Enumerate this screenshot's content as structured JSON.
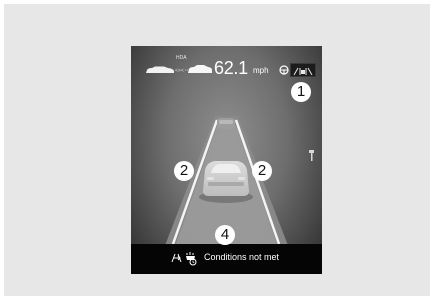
{
  "hud": {
    "mode_label": "HDA",
    "speed_value": "62.1",
    "speed_unit": "mph"
  },
  "status": {
    "message": "Conditions not met"
  },
  "callouts": [
    "1",
    "2",
    "2",
    "4"
  ],
  "colors": {
    "frame_background": "#e7e7e7",
    "hud_text": "#ffffff",
    "status_bar": "#050505",
    "callout_circle": "#ffffff"
  },
  "icons": {
    "lead_vehicle": "car-silhouette-icon",
    "follow_distance": "distance-arrows-icon",
    "steering": "steering-wheel-icon",
    "lane_assist": "lane-following-icon",
    "lane_status": "lane-change-icon",
    "hands_off": "hand-icon",
    "ego_vehicle": "car-rear-icon"
  }
}
